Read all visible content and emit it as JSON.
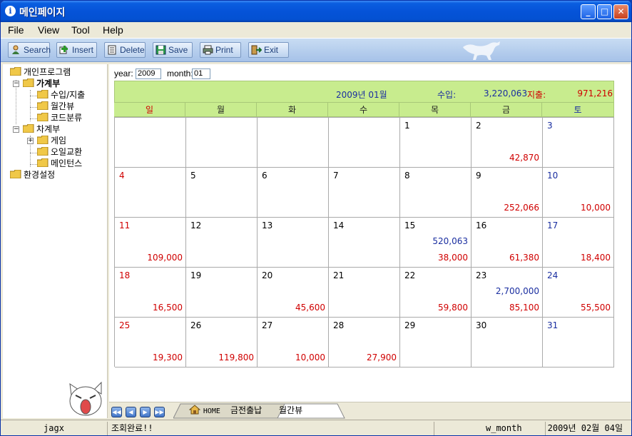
{
  "window": {
    "title": "메인페이지"
  },
  "titlebar_buttons": {
    "minimize": "_",
    "maximize": "□",
    "close": "✕"
  },
  "menu": [
    "File",
    "View",
    "Tool",
    "Help"
  ],
  "toolbar": {
    "search": "Search",
    "insert": "Insert",
    "delete": "Delete",
    "save": "Save",
    "print": "Print",
    "exit": "Exit"
  },
  "tree": {
    "root": "개인프로그램",
    "household": "가계부",
    "income_expense": "수입/지출",
    "monthly_view": "월간뷰",
    "code_class": "코드분류",
    "car": "차계부",
    "game": "게임",
    "oil_change": "오일교환",
    "maintenance": "메인턴스",
    "settings": "환경설정",
    "expander_minus": "−",
    "expander_plus": "+"
  },
  "filter": {
    "year_label": "year:",
    "year_value": "2009",
    "month_label": "month:",
    "month_value": "01"
  },
  "calendar": {
    "month_title": "2009년  01월",
    "income_label": "수입:",
    "income_total": "3,220,063",
    "expense_label": "지출:",
    "expense_total": "971,216",
    "weekdays": [
      "일",
      "월",
      "화",
      "수",
      "목",
      "금",
      "토"
    ],
    "weeks": [
      [
        {
          "day": "",
          "inc": "",
          "exp": ""
        },
        {
          "day": "",
          "inc": "",
          "exp": ""
        },
        {
          "day": "",
          "inc": "",
          "exp": ""
        },
        {
          "day": "",
          "inc": "",
          "exp": ""
        },
        {
          "day": "1",
          "inc": "",
          "exp": ""
        },
        {
          "day": "2",
          "inc": "",
          "exp": "42,870"
        },
        {
          "day": "3",
          "inc": "",
          "exp": ""
        }
      ],
      [
        {
          "day": "4",
          "inc": "",
          "exp": ""
        },
        {
          "day": "5",
          "inc": "",
          "exp": ""
        },
        {
          "day": "6",
          "inc": "",
          "exp": ""
        },
        {
          "day": "7",
          "inc": "",
          "exp": ""
        },
        {
          "day": "8",
          "inc": "",
          "exp": ""
        },
        {
          "day": "9",
          "inc": "",
          "exp": "252,066"
        },
        {
          "day": "10",
          "inc": "",
          "exp": "10,000"
        }
      ],
      [
        {
          "day": "11",
          "inc": "",
          "exp": "109,000"
        },
        {
          "day": "12",
          "inc": "",
          "exp": ""
        },
        {
          "day": "13",
          "inc": "",
          "exp": ""
        },
        {
          "day": "14",
          "inc": "",
          "exp": ""
        },
        {
          "day": "15",
          "inc": "520,063",
          "exp": "38,000"
        },
        {
          "day": "16",
          "inc": "",
          "exp": "61,380"
        },
        {
          "day": "17",
          "inc": "",
          "exp": "18,400"
        }
      ],
      [
        {
          "day": "18",
          "inc": "",
          "exp": "16,500"
        },
        {
          "day": "19",
          "inc": "",
          "exp": ""
        },
        {
          "day": "20",
          "inc": "",
          "exp": "45,600"
        },
        {
          "day": "21",
          "inc": "",
          "exp": ""
        },
        {
          "day": "22",
          "inc": "",
          "exp": "59,800"
        },
        {
          "day": "23",
          "inc": "2,700,000",
          "exp": "85,100"
        },
        {
          "day": "24",
          "inc": "",
          "exp": "55,500"
        }
      ],
      [
        {
          "day": "25",
          "inc": "",
          "exp": "19,300"
        },
        {
          "day": "26",
          "inc": "",
          "exp": "119,800"
        },
        {
          "day": "27",
          "inc": "",
          "exp": "10,000"
        },
        {
          "day": "28",
          "inc": "",
          "exp": "27,900"
        },
        {
          "day": "29",
          "inc": "",
          "exp": ""
        },
        {
          "day": "30",
          "inc": "",
          "exp": ""
        },
        {
          "day": "31",
          "inc": "",
          "exp": ""
        }
      ]
    ]
  },
  "nav_buttons": {
    "first": "◀◀",
    "prev": "◀",
    "next": "▶",
    "last": "▶▶"
  },
  "tabs": {
    "home": "HOME",
    "cash": "금전출납",
    "monthly": "월간뷰"
  },
  "status": {
    "user": "jagx",
    "message": "조회완료!!",
    "screen": "w_month",
    "date": "2009년 02월 04일"
  },
  "colors": {
    "calendar_header": "#c8ec8e",
    "income": "#1a2ea0",
    "expense": "#d00000",
    "titlebar": "#0553d8"
  },
  "icons": [
    "info-icon",
    "search-icon",
    "insert-icon",
    "delete-icon",
    "save-icon",
    "print-icon",
    "exit-icon",
    "folder-icon",
    "home-icon",
    "puma-logo",
    "mascot-icon"
  ]
}
